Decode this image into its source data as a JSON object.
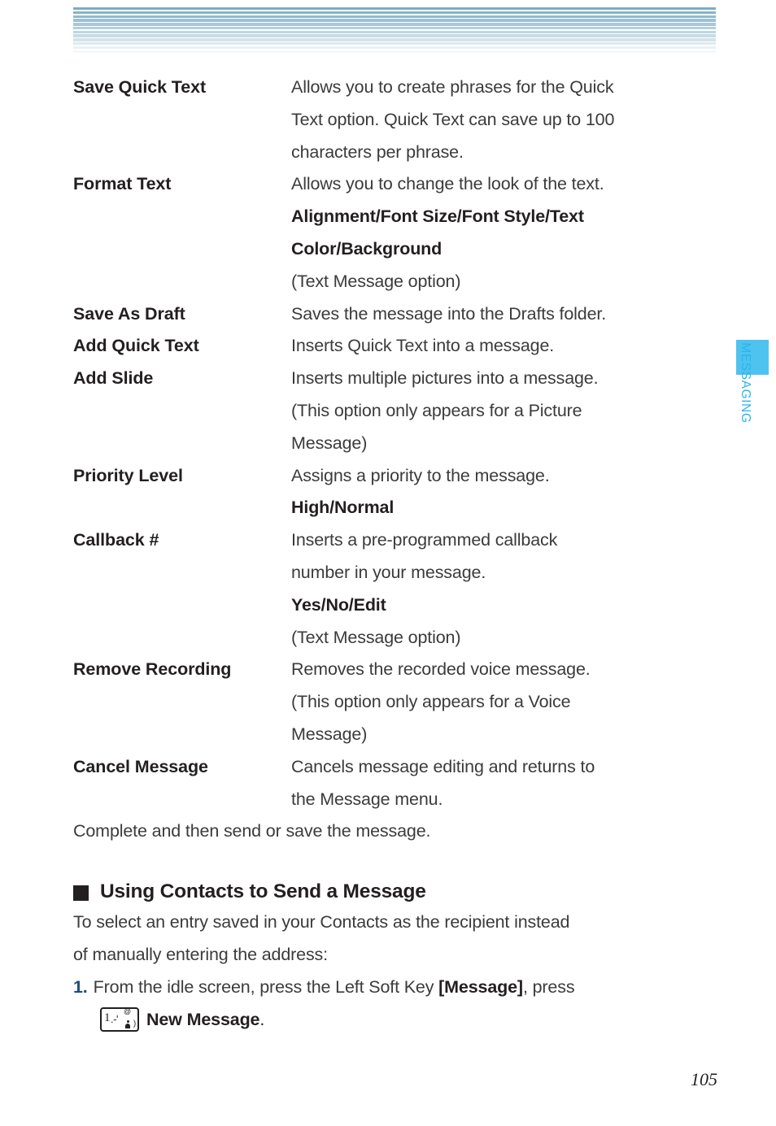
{
  "page": {
    "number": "105",
    "side_tab_label": "MESSAGING",
    "side_tab_color": "#4ec3f0",
    "accent_blue": "#1b4e7d"
  },
  "definitions": [
    {
      "term": "Save Quick Text",
      "lines": [
        {
          "text": "Allows you to create phrases for the Quick",
          "bold": false
        },
        {
          "text": "Text option. Quick Text can save up to 100",
          "bold": false
        },
        {
          "text": "characters per phrase.",
          "bold": false
        }
      ]
    },
    {
      "term": "Format Text",
      "lines": [
        {
          "text": "Allows you to change the look of the text.",
          "bold": false
        },
        {
          "text": "Alignment/Font Size/Font Style/Text",
          "bold": true
        },
        {
          "text": "Color/Background",
          "bold": true
        },
        {
          "text": "(Text Message option)",
          "bold": false
        }
      ]
    },
    {
      "term": "Save As Draft",
      "lines": [
        {
          "text": "Saves the message into the Drafts folder.",
          "bold": false
        }
      ]
    },
    {
      "term": "Add Quick Text",
      "lines": [
        {
          "text": "Inserts Quick Text into a message.",
          "bold": false
        }
      ]
    },
    {
      "term": "Add Slide",
      "lines": [
        {
          "text": "Inserts multiple pictures into a message.",
          "bold": false
        },
        {
          "text": "(This option only appears for a Picture",
          "bold": false
        },
        {
          "text": "Message)",
          "bold": false
        }
      ]
    },
    {
      "term": "Priority Level",
      "lines": [
        {
          "text": "Assigns a priority to the message.",
          "bold": false
        },
        {
          "text": "High/Normal",
          "bold": true
        }
      ]
    },
    {
      "term": "Callback #",
      "lines": [
        {
          "text": "Inserts a pre-programmed callback",
          "bold": false
        },
        {
          "text": "number in your message.",
          "bold": false
        },
        {
          "text": "Yes/No/Edit",
          "bold": true
        },
        {
          "text": "(Text Message option)",
          "bold": false
        }
      ]
    },
    {
      "term": "Remove Recording",
      "lines": [
        {
          "text": "Removes the recorded voice message.",
          "bold": false
        },
        {
          "text": "(This option only appears for a Voice",
          "bold": false
        },
        {
          "text": "Message)",
          "bold": false
        }
      ]
    },
    {
      "term": "Cancel Message",
      "lines": [
        {
          "text": "Cancels message editing and returns to",
          "bold": false
        },
        {
          "text": "the Message menu.",
          "bold": false
        }
      ]
    }
  ],
  "closing_note": "Complete and then send or save the message.",
  "section": {
    "heading": "Using Contacts to Send a Message",
    "intro_line1": "To select an entry saved in your Contacts as the recipient instead",
    "intro_line2": "of manually entering the address:",
    "step1": {
      "number": "1.",
      "text_before": "From the idle screen, press the Left Soft Key ",
      "key_label": "[Message]",
      "text_after": ", press",
      "continuation_label": "New Message",
      "continuation_period": ".",
      "key_icon_digit": "1",
      "key_icon_punct": ".-'",
      "key_icon_at": "@"
    }
  }
}
